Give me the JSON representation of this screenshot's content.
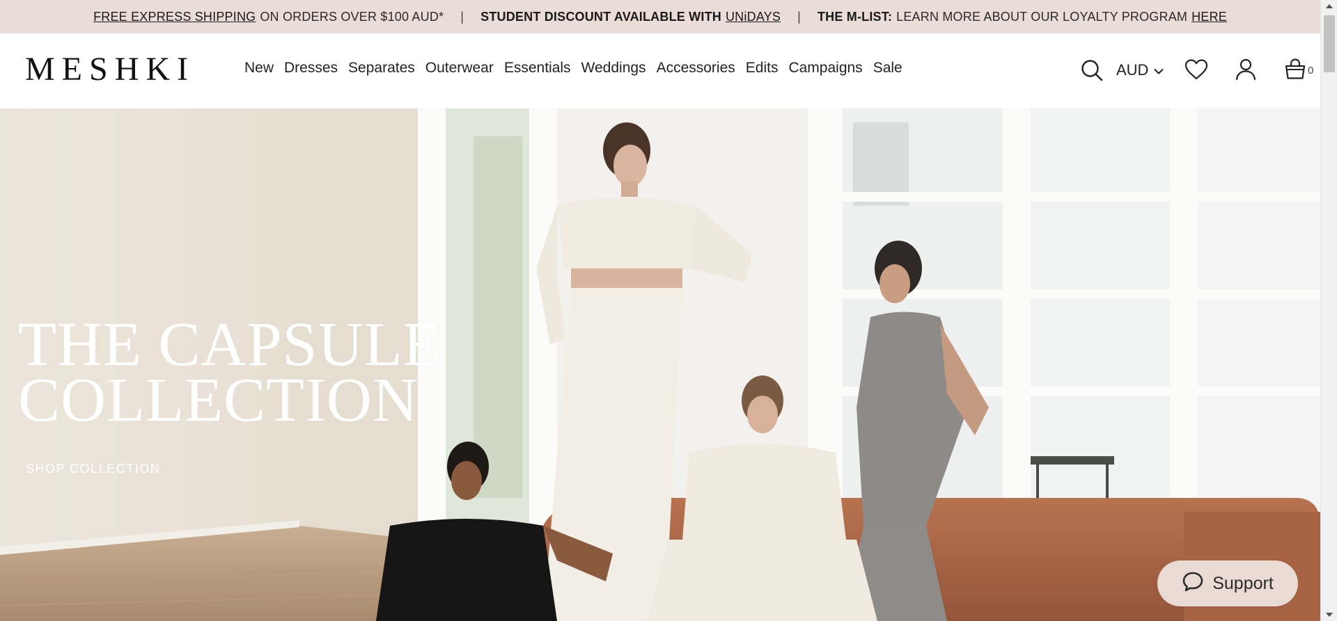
{
  "announcement": {
    "shipping_link": "FREE EXPRESS SHIPPING",
    "shipping_rest": "ON ORDERS OVER $100 AUD*",
    "separator": "|",
    "student_text": "STUDENT DISCOUNT AVAILABLE WITH",
    "student_link": "UNiDAYS",
    "mlist_label": "THE M-LIST:",
    "mlist_text": "LEARN MORE ABOUT OUR LOYALTY PROGRAM",
    "mlist_link": "HERE"
  },
  "header": {
    "logo": "MESHKI",
    "nav": [
      "New",
      "Dresses",
      "Separates",
      "Outerwear",
      "Essentials",
      "Weddings",
      "Accessories",
      "Edits",
      "Campaigns",
      "Sale"
    ],
    "currency": "AUD",
    "bag_count": "0",
    "icons": [
      "search-icon",
      "chevron-down-icon",
      "heart-icon",
      "user-icon",
      "bag-icon"
    ]
  },
  "hero": {
    "title_line1": "THE CAPSULE",
    "title_line2": "COLLECTION",
    "cta": "SHOP COLLECTION"
  },
  "support": {
    "label": "Support",
    "icon": "chat-bubble-icon"
  },
  "colors": {
    "announcement_bg": "#eadcd7",
    "support_bg": "#e9dbd4",
    "text_dark": "#222222",
    "hero_text": "#ffffff"
  }
}
